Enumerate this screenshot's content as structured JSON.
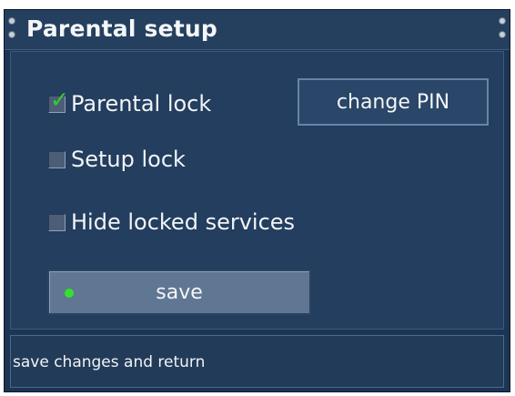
{
  "window": {
    "title": "Parental setup"
  },
  "options": [
    {
      "label": "Parental lock",
      "checked": true
    },
    {
      "label": "Setup lock",
      "checked": false
    },
    {
      "label": "Hide locked services",
      "checked": false
    }
  ],
  "buttons": {
    "change_pin": "change PIN",
    "save": "save"
  },
  "colors": {
    "checkmark": "#2fd02a",
    "save_indicator": "#33e22a",
    "background": "#1d3452"
  },
  "status": {
    "text": "save changes and return"
  }
}
